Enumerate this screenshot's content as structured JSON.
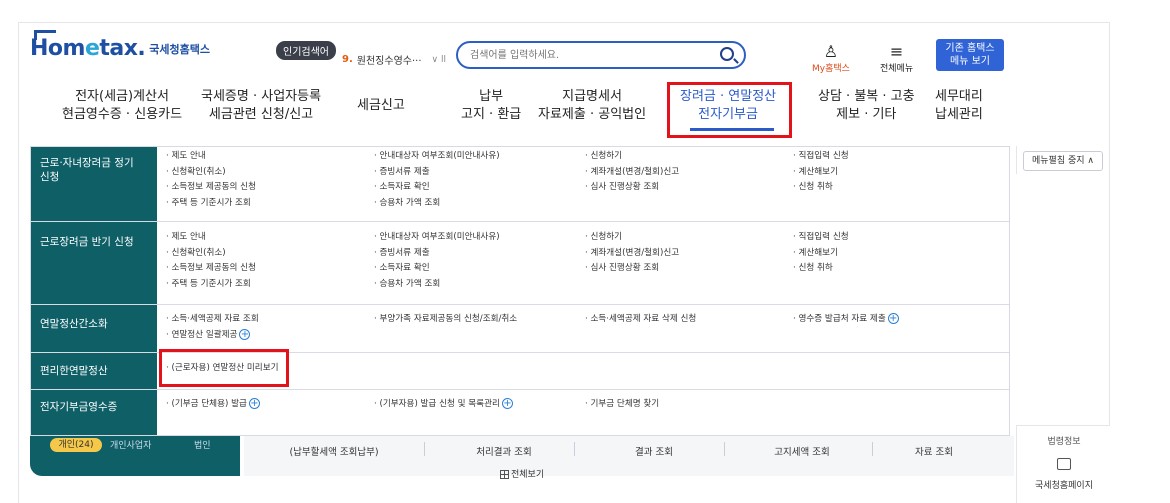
{
  "header": {
    "logo_text": "Hometax",
    "logo_sub": "국세청홈택스",
    "popular_label": "인기검색어",
    "popular_rank": "9.",
    "popular_term": "원천징수영수···",
    "popular_controls": "∨ ll",
    "search_placeholder": "검색어를 입력하세요.",
    "my_label": "My홈택스",
    "allmenu_label": "전체메뉴",
    "legacy_btn_line1": "기존 홈택스",
    "legacy_btn_line2": "메뉴 보기"
  },
  "gnb": [
    {
      "line1": "전자(세금)계산서",
      "line2": "현금영수증 · 신용카드"
    },
    {
      "line1": "국세증명 · 사업자등록",
      "line2": "세금관련 신청/신고"
    },
    {
      "line1": "세금신고",
      "line2": ""
    },
    {
      "line1": "납부",
      "line2": "고지 · 환급"
    },
    {
      "line1": "지급명세서",
      "line2": "자료제출 · 공익법인"
    },
    {
      "line1": "장려금 · 연말정산",
      "line2": "전자기부금"
    },
    {
      "line1": "상담 · 불복 · 고충",
      "line2": "제보 · 기타"
    },
    {
      "line1": "세무대리",
      "line2": "납세관리"
    }
  ],
  "mega": {
    "sections": [
      {
        "title_l1": "근로·자녀장려금 정기",
        "title_l2": "신청",
        "cols": [
          [
            "· 제도 안내",
            "· 신청확인(취소)",
            "· 소득정보 제공동의 신청",
            "· 주택 등 기준시가 조회"
          ],
          [
            "· 안내대상자 여부조회(미안내사유)",
            "· 증빙서류 제출",
            "· 소득자료 확인",
            "· 승용차 가액 조회"
          ],
          [
            "· 신청하기",
            "· 계좌개설(변경/철회)신고",
            "· 심사 진행상황 조회"
          ],
          [
            "· 직접입력 신청",
            "· 계산해보기",
            "· 신청 취하"
          ]
        ]
      },
      {
        "title_l1": "근로장려금 반기 신청",
        "title_l2": "",
        "cols": [
          [
            "· 제도 안내",
            "· 신청확인(취소)",
            "· 소득정보 제공동의 신청",
            "· 주택 등 기준시가 조회"
          ],
          [
            "· 안내대상자 여부조회(미안내사유)",
            "· 증빙서류 제출",
            "· 소득자료 확인",
            "· 승용차 가액 조회"
          ],
          [
            "· 신청하기",
            "· 계좌개설(변경/철회)신고",
            "· 심사 진행상황 조회"
          ],
          [
            "· 직접입력 신청",
            "· 계산해보기",
            "· 신청 취하"
          ]
        ]
      },
      {
        "title_l1": "연말정산간소화",
        "title_l2": "",
        "cols": [
          [
            "· 소득·세액공제 자료 조회",
            "· 연말정산 일괄제공"
          ],
          [
            "· 부양가족 자료제공동의 신청/조회/취소"
          ],
          [
            "· 소득·세액공제 자료 삭제 신청"
          ],
          [
            "· 영수증 발급처 자료 제출"
          ]
        ]
      },
      {
        "title_l1": "편리한연말정산",
        "title_l2": "",
        "cols": [
          [
            "· (근로자용) 연말정산 미리보기"
          ],
          [],
          [],
          []
        ]
      },
      {
        "title_l1": "전자기부금영수증",
        "title_l2": "",
        "cols": [
          [
            "· (기부금 단체용) 발급"
          ],
          [
            "· (기부자용) 발급 신청 및 목록관리"
          ],
          [
            "· 기부금 단체명 찾기"
          ],
          []
        ]
      }
    ],
    "collapse_btn": "메뉴펼침 중지  ∧"
  },
  "bottom": {
    "pill": "개인(24)",
    "t1": "개인사업자",
    "t2": "법인",
    "items": [
      "(납부할세액 조회납부)",
      "처리결과 조회",
      "결과 조회",
      "고지세액 조회",
      "자료 조회"
    ],
    "all_view": "전체보기",
    "right_cut": "법령정보",
    "right_label": "국세청홈페이지"
  }
}
